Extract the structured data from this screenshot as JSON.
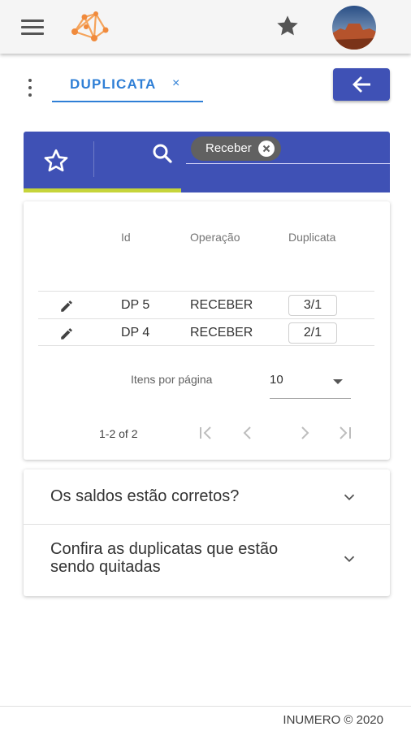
{
  "appbar": {
    "menu_icon": "hamburger-menu-icon",
    "logo_icon": "network-logo-icon",
    "favorite_icon": "star-icon",
    "avatar_icon": "user-avatar"
  },
  "tabs": [
    {
      "label": "DUPLICATA",
      "close_label": "×"
    }
  ],
  "colors": {
    "primary": "#3f51b5",
    "tab_active": "#2f7fd6",
    "progress": "#c6d43a",
    "chip": "#616161"
  },
  "filter": {
    "chip_label": "Receber",
    "search_placeholder": "",
    "progress_fraction": 0.43
  },
  "table": {
    "columns": [
      "Id",
      "Operação",
      "Duplicata"
    ],
    "rows": [
      {
        "id": "DP 5",
        "operacao": "RECEBER",
        "duplicata": "3/1"
      },
      {
        "id": "DP 4",
        "operacao": "RECEBER",
        "duplicata": "2/1"
      }
    ]
  },
  "pagination": {
    "items_per_page_label": "Itens por página",
    "items_per_page_value": "10",
    "range_label": "1-2 of 2"
  },
  "accordion": [
    {
      "title": "Os saldos estão corretos?"
    },
    {
      "title_line1": "Confira as duplicatas que estão",
      "title_line2": "sendo quitadas"
    }
  ],
  "footer": {
    "text": "INUMERO © 2020"
  }
}
